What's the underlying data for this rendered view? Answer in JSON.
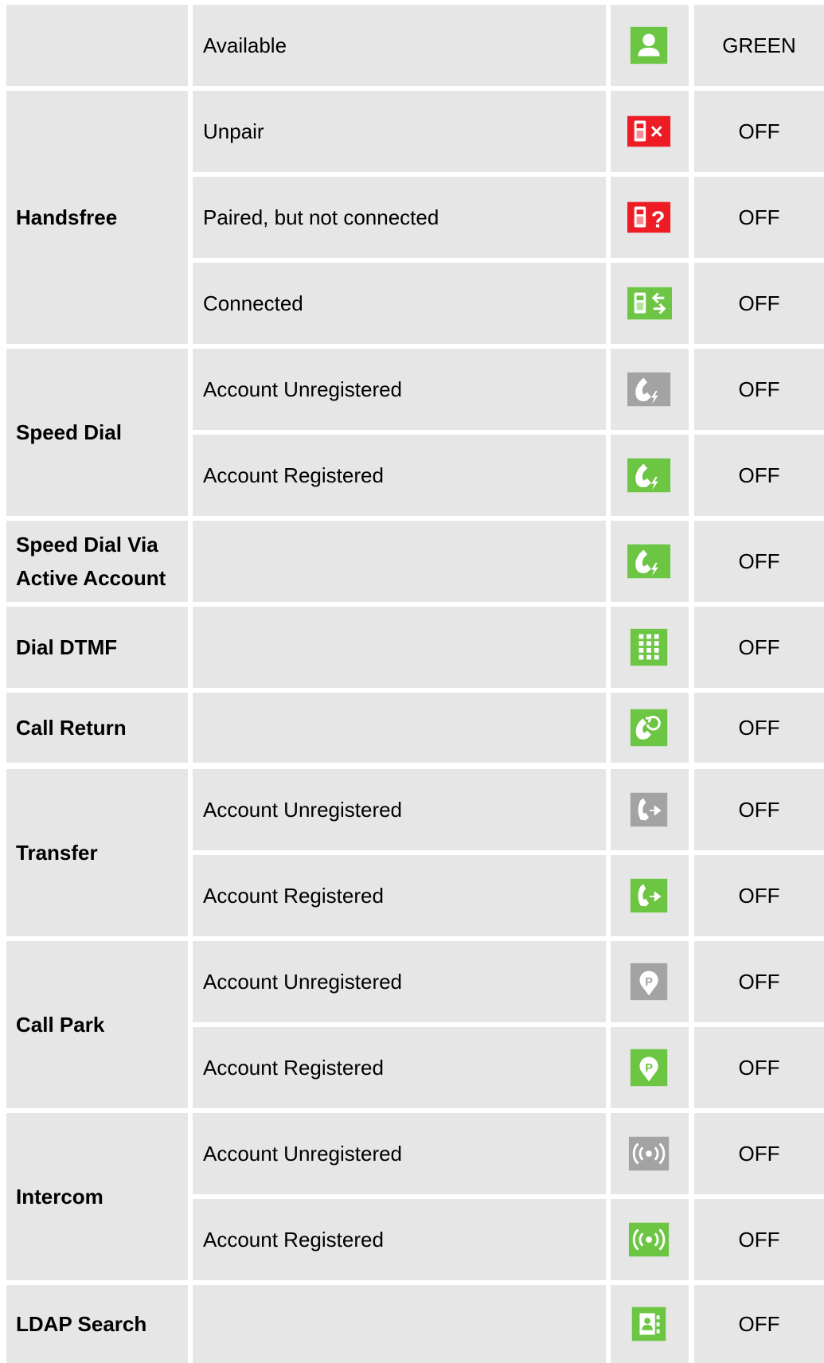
{
  "colors": {
    "cell_bg": "#e6e6e6",
    "grid": "#ffffff",
    "icon_green": "#6cc644",
    "icon_red": "#ee1c25",
    "icon_gray": "#a3a3a3"
  },
  "rows": [
    {
      "feature": "",
      "status": "Available",
      "icon": "available-person-icon",
      "color": "green",
      "led": "GREEN"
    },
    {
      "feature": "Handsfree",
      "status": "Unpair",
      "icon": "phone-unpair-icon",
      "color": "red",
      "led": "OFF"
    },
    {
      "feature": "Handsfree",
      "status": "Paired, but not connected",
      "icon": "phone-paired-question-icon",
      "color": "red",
      "led": "OFF"
    },
    {
      "feature": "Handsfree",
      "status": "Connected",
      "icon": "phone-connected-icon",
      "color": "green",
      "led": "OFF"
    },
    {
      "feature": "Speed Dial",
      "status": "Account Unregistered",
      "icon": "speed-dial-icon",
      "color": "gray",
      "led": "OFF"
    },
    {
      "feature": "Speed Dial",
      "status": "Account Registered",
      "icon": "speed-dial-icon",
      "color": "green",
      "led": "OFF"
    },
    {
      "feature": "Speed Dial Via Active Account",
      "status": "",
      "icon": "speed-dial-icon",
      "color": "green",
      "led": "OFF"
    },
    {
      "feature": "Dial DTMF",
      "status": "",
      "icon": "dtmf-keypad-icon",
      "color": "green",
      "led": "OFF"
    },
    {
      "feature": "Call Return",
      "status": "",
      "icon": "call-return-icon",
      "color": "green",
      "led": "OFF"
    },
    {
      "feature": "Transfer",
      "status": "Account Unregistered",
      "icon": "transfer-icon",
      "color": "gray",
      "led": "OFF"
    },
    {
      "feature": "Transfer",
      "status": "Account Registered",
      "icon": "transfer-icon",
      "color": "green",
      "led": "OFF"
    },
    {
      "feature": "Call Park",
      "status": "Account Unregistered",
      "icon": "call-park-icon",
      "color": "gray",
      "led": "OFF"
    },
    {
      "feature": "Call Park",
      "status": "Account Registered",
      "icon": "call-park-icon",
      "color": "green",
      "led": "OFF"
    },
    {
      "feature": "Intercom",
      "status": "Account Unregistered",
      "icon": "intercom-icon",
      "color": "gray",
      "led": "OFF"
    },
    {
      "feature": "Intercom",
      "status": "Account Registered",
      "icon": "intercom-icon",
      "color": "green",
      "led": "OFF"
    },
    {
      "feature": "LDAP Search",
      "status": "",
      "icon": "ldap-contact-book-icon",
      "color": "green",
      "led": "OFF"
    }
  ]
}
